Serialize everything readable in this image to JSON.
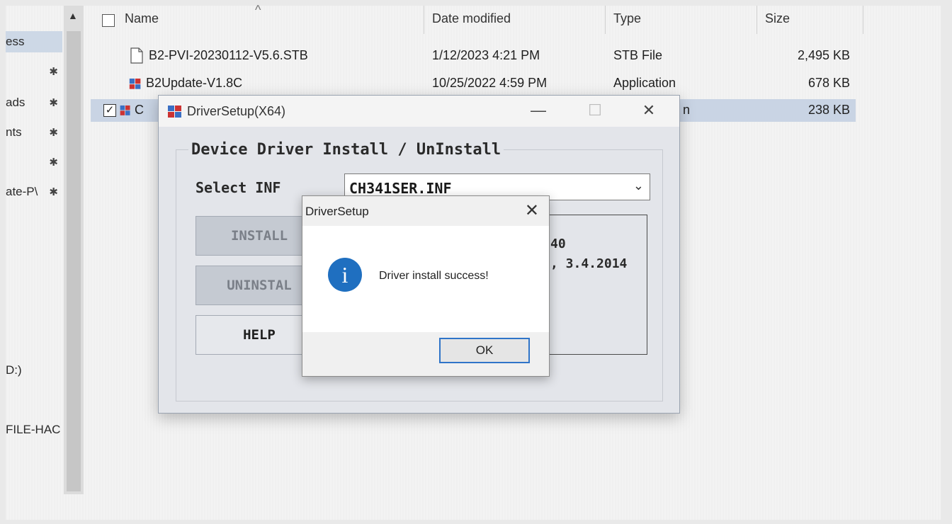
{
  "nav": {
    "items": [
      {
        "label": "ess",
        "pinned": false,
        "selected": true
      },
      {
        "label": "",
        "pinned": true,
        "selected": false
      },
      {
        "label": "ads",
        "pinned": true,
        "selected": false
      },
      {
        "label": "nts",
        "pinned": true,
        "selected": false
      },
      {
        "label": "",
        "pinned": true,
        "selected": false
      },
      {
        "label": "ate-P\\",
        "pinned": true,
        "selected": false
      },
      {
        "label": "D:)",
        "pinned": false,
        "selected": false
      },
      {
        "label": "FILE-HAC",
        "pinned": false,
        "selected": false
      }
    ],
    "pin_glyph": "✱",
    "scroll_up_glyph": "▲"
  },
  "list": {
    "columns": {
      "name": "Name",
      "date": "Date modified",
      "type": "Type",
      "size": "Size"
    },
    "sort_glyph": "^",
    "rows": [
      {
        "name": "B2-PVI-20230112-V5.6.STB",
        "date": "1/12/2023 4:21 PM",
        "type": "STB File",
        "size": "2,495 KB",
        "icon": "document-icon",
        "selected": false
      },
      {
        "name": "B2Update-V1.8C",
        "date": "10/25/2022 4:59 PM",
        "type": "Application",
        "size": "678 KB",
        "icon": "application-icon",
        "selected": false
      },
      {
        "name": "C",
        "date": "",
        "type": "n",
        "size": "238 KB",
        "icon": "setup-icon",
        "selected": true
      }
    ],
    "checked_glyph": "✓"
  },
  "setup_window": {
    "title": "DriverSetup(X64)",
    "minimize": "—",
    "maximize": "☐",
    "close": "✕",
    "group_title": "Device Driver Install / UnInstall",
    "select_label": "Select INF",
    "inf_value": "CH341SER.INF",
    "inf_chevron": "⌄",
    "buttons": {
      "install": "INSTALL",
      "uninstall": "UNINSTAL",
      "help": "HELP"
    },
    "info_lines": [
      "40",
      ", 3.4.2014"
    ]
  },
  "message_box": {
    "title": "DriverSetup",
    "close": "✕",
    "icon": "info-icon",
    "icon_glyph": "i",
    "text": "Driver install success!",
    "ok_label": "OK"
  },
  "colors": {
    "selection": "#c9d4e4",
    "info_icon": "#1f6fc0",
    "ok_focus": "#2f74c8"
  }
}
